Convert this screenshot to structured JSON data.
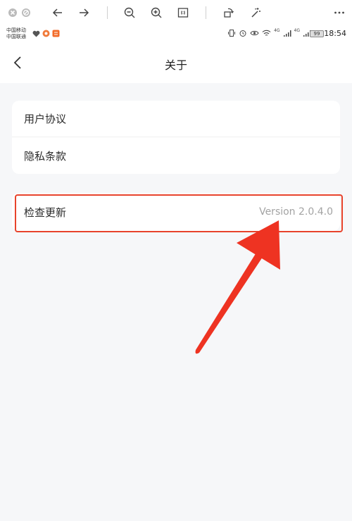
{
  "status_bar": {
    "carrier_1": "中国移动",
    "carrier_2": "中国联通",
    "net_1": "4G",
    "net_2": "4G",
    "battery": "99",
    "time": "18:54"
  },
  "header": {
    "title": "关于"
  },
  "menu": {
    "items": [
      {
        "label": "用户协议"
      },
      {
        "label": "隐私条款"
      }
    ]
  },
  "update": {
    "label": "检查更新",
    "version": "Version 2.0.4.0"
  },
  "colors": {
    "highlight": "#e8432c",
    "arrow": "#ee3322",
    "page_bg": "#f6f7f9",
    "card_bg": "#ffffff"
  }
}
